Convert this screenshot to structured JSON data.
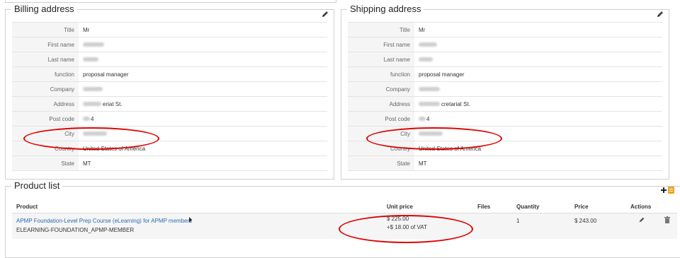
{
  "billing": {
    "legend": "Billing address",
    "rows": [
      {
        "label": "Title",
        "value": "Mr"
      },
      {
        "label": "First name",
        "value": ""
      },
      {
        "label": "Last name",
        "value": ""
      },
      {
        "label": "function",
        "value": "proposal manager"
      },
      {
        "label": "Company",
        "value": ""
      },
      {
        "label": "Address",
        "value": "eriat St."
      },
      {
        "label": "Post code",
        "value": "4"
      },
      {
        "label": "City",
        "value": ""
      },
      {
        "label": "Country",
        "value": "United States of America"
      },
      {
        "label": "State",
        "value": "MT"
      }
    ]
  },
  "shipping": {
    "legend": "Shipping address",
    "rows": [
      {
        "label": "Title",
        "value": "Mr"
      },
      {
        "label": "First name",
        "value": ""
      },
      {
        "label": "Last name",
        "value": ""
      },
      {
        "label": "function",
        "value": "proposal manager"
      },
      {
        "label": "Company",
        "value": ""
      },
      {
        "label": "Address",
        "value": "cretariat St."
      },
      {
        "label": "Post code",
        "value": "4"
      },
      {
        "label": "City",
        "value": ""
      },
      {
        "label": "Country",
        "value": "United States of America"
      },
      {
        "label": "State",
        "value": "MT"
      }
    ]
  },
  "products": {
    "legend": "Product list",
    "columns": {
      "product": "Product",
      "unit_price": "Unit price",
      "files": "Files",
      "quantity": "Quantity",
      "price": "Price",
      "actions": "Actions"
    },
    "items": [
      {
        "name": "APMP Foundation-Level Prep Course (eLearning) for APMP members",
        "sku": "ELEARNING-FOUNDATION_APMP-MEMBER",
        "unit_price": "$ 225.00",
        "vat": "+$ 18.00 of VAT",
        "quantity": "1",
        "price": "$ 243.00"
      }
    ]
  },
  "colors": {
    "highlight": "#e00000",
    "link": "#2a6ab7",
    "add_icon_accent": "#f0a020"
  },
  "icons": [
    "pencil-icon",
    "plus-icon",
    "list-icon",
    "chevron-right-icon",
    "trash-icon"
  ]
}
